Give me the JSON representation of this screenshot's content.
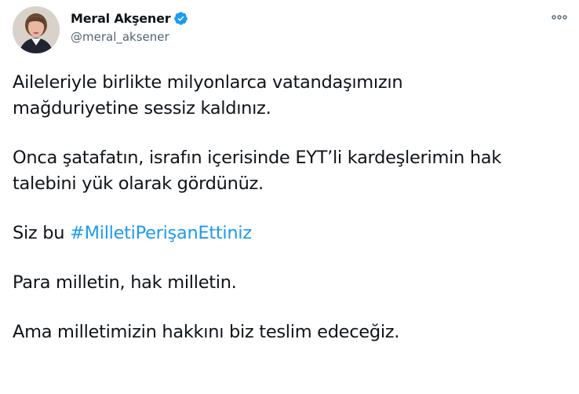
{
  "tweet": {
    "author": {
      "display_name": "Meral Akşener",
      "handle": "@meral_aksener",
      "verified": true
    },
    "paragraphs": [
      [
        "Aileleriyle birlikte milyonlarca vatandaşımızın",
        "mağduriyetine sessiz kaldınız."
      ],
      [
        "Onca şatafatın, israfın içerisinde EYT’li kardeşlerimin hak",
        "talebini yük olarak gördünüz."
      ],
      [
        "Siz bu "
      ],
      [
        "Para milletin, hak milletin."
      ],
      [
        "Ama milletimizin hakkını biz teslim edeceğiz."
      ]
    ],
    "hashtag": "#MilletiPerişanEttiniz"
  },
  "colors": {
    "text": "#0f1419",
    "secondary": "#536471",
    "accent": "#1d9bf0"
  },
  "icons": {
    "verified": "verified-badge-icon",
    "more": "more-options-icon"
  }
}
